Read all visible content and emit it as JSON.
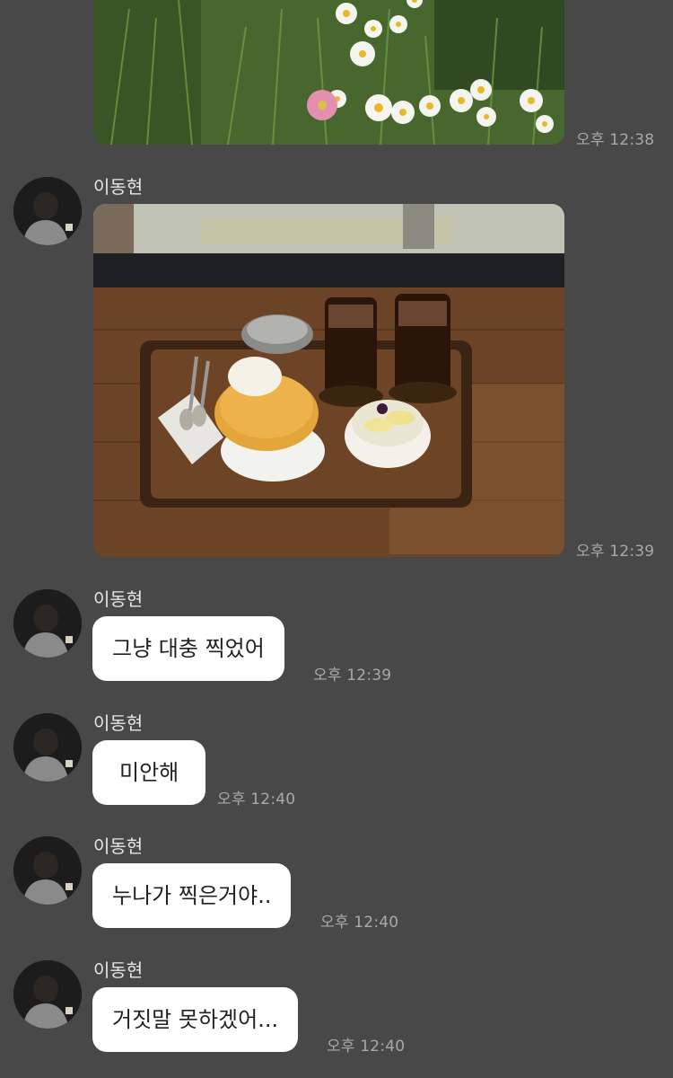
{
  "messages": [
    {
      "type": "image",
      "image_desc": "flower-photo",
      "time": "오후 12:38"
    },
    {
      "type": "image",
      "sender": "이동현",
      "image_desc": "cafe-dessert-photo",
      "time": "오후 12:39"
    },
    {
      "type": "text",
      "sender": "이동현",
      "text": "그냥 대충 찍었어",
      "time": "오후 12:39"
    },
    {
      "type": "text",
      "sender": "이동현",
      "text": "미안해",
      "time": "오후 12:40"
    },
    {
      "type": "text",
      "sender": "이동현",
      "text": "누나가 찍은거야..",
      "time": "오후 12:40"
    },
    {
      "type": "text",
      "sender": "이동현",
      "text": "거짓말 못하겠어...",
      "time": "오후 12:40"
    }
  ],
  "colors": {
    "background": "#484848",
    "bubble": "#ffffff",
    "timestamp": "#a9a9a9",
    "sender_name": "#e6e6e6"
  }
}
